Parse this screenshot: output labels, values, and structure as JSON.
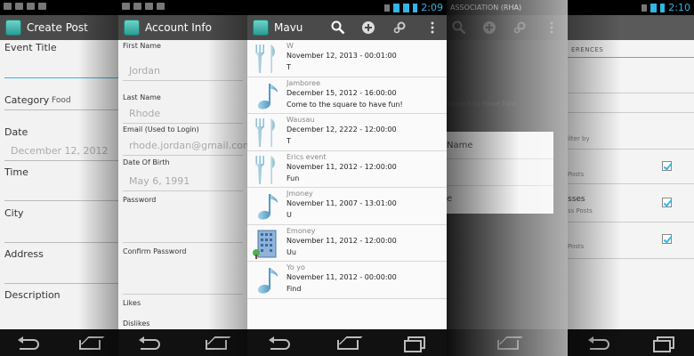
{
  "create_post": {
    "title": "Create Post",
    "event_title_label": "Event Title",
    "category_label": "Category",
    "category_value": "Food",
    "date_label": "Date",
    "date_value": "December 12, 2012",
    "time_label": "Time",
    "city_label": "City",
    "address_label": "Address",
    "description_label": "Description"
  },
  "account_info": {
    "title": "Account Info",
    "first_name_label": "First Name",
    "first_name_value": "Jordan",
    "last_name_label": "Last Name",
    "last_name_value": "Rhode",
    "email_label": "Email (Used to Login)",
    "email_value": "rhode.jordan@gmail.com",
    "dob_label": "Date Of Birth",
    "dob_value": "May 6, 1991",
    "password_label": "Password",
    "confirm_password_label": "Confirm Password",
    "likes_label": "Likes",
    "dislikes_label": "Dislikes"
  },
  "mavu": {
    "title": "Mavu",
    "status_time": "2:09",
    "action_icons": [
      "search-icon",
      "add-icon",
      "settings-icon",
      "overflow-menu-icon"
    ],
    "items": [
      {
        "name": "W",
        "date": "November 12, 2013 - 00:01:00",
        "desc": "T",
        "icon": "food-icon"
      },
      {
        "name": "Jamboree",
        "date": "December 15, 2012 - 16:00:00",
        "desc": "Come to the square to have fun!",
        "icon": "music-icon"
      },
      {
        "name": "Wausau",
        "date": "December 12, 2222 - 12:00:00",
        "desc": "T",
        "icon": "food-icon"
      },
      {
        "name": "Erics event",
        "date": "November 11, 2012 - 12:00:00",
        "desc": "Fun",
        "icon": "food-icon"
      },
      {
        "name": "Jmoney",
        "date": "November 11, 2007 - 13:01:00",
        "desc": "U",
        "icon": "music-icon"
      },
      {
        "name": "Emoney",
        "date": "November 11, 2012 - 12:00:00",
        "desc": "Uu",
        "icon": "building-icon"
      },
      {
        "name": "Yo yo",
        "date": "November 11, 2012 - 00:00:00",
        "desc": "Find",
        "icon": "music-icon"
      }
    ]
  },
  "rha": {
    "title": "ASSOCIATION (RHA)",
    "faded_text": "square to have fun!",
    "dialog_items": [
      "Name",
      "e"
    ]
  },
  "prefs": {
    "status_time": "2:10",
    "header": "ERENCES",
    "filter_label": "ilter by",
    "rows": [
      {
        "title": "",
        "sub": "Posts",
        "checked": true
      },
      {
        "title": "sses",
        "sub": "ss Posts",
        "checked": true
      },
      {
        "title": "",
        "sub": "Posts",
        "checked": true
      }
    ]
  },
  "colors": {
    "accent": "#33b5e5",
    "actionbar": "#4a4a4a",
    "statusbar": "#000000"
  }
}
